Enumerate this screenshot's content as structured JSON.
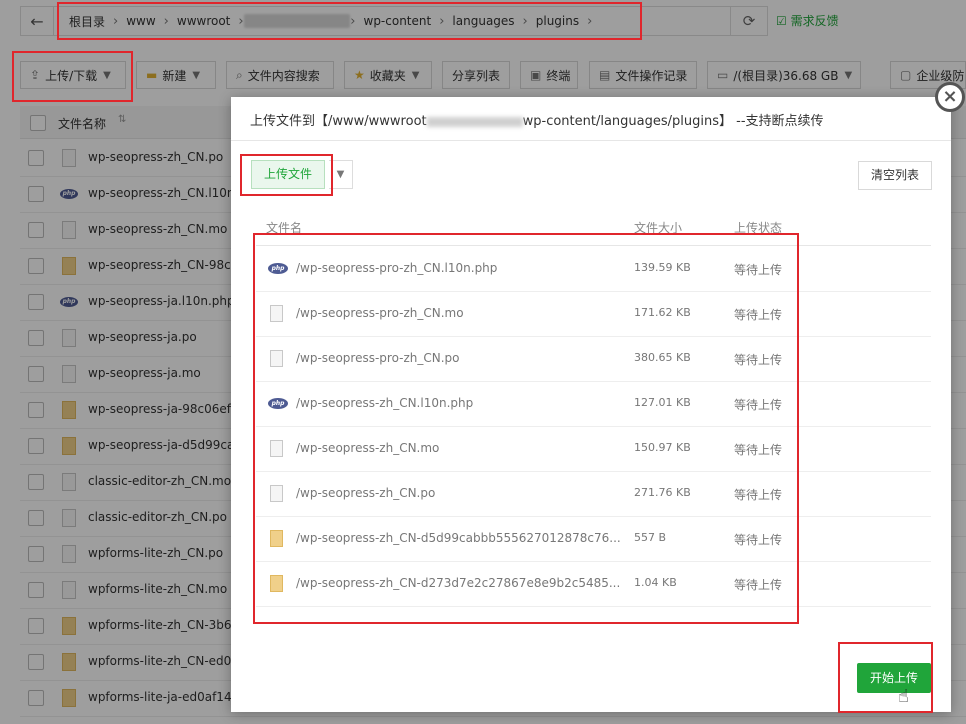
{
  "pathbar": {
    "back": "←",
    "crumbs": [
      "根目录",
      "www",
      "wwwroot",
      "wp-content",
      "languages",
      "plugins"
    ],
    "blurred_crumb": "■■■■■■■■",
    "refresh": "⟳"
  },
  "feedback": "需求反馈",
  "toolbar": {
    "upload_download": "上传/下载",
    "new": "新建",
    "content_search": "文件内容搜索",
    "favorites": "收藏夹",
    "share_list": "分享列表",
    "terminal": "终端",
    "file_log": "文件操作记录",
    "disk": "/(根目录)36.68 GB",
    "enterprise": "企业级防"
  },
  "file_list": {
    "header_name": "文件名称",
    "rows": [
      {
        "name": "wp-seopress-zh_CN.po",
        "icon": "doc"
      },
      {
        "name": "wp-seopress-zh_CN.l10n",
        "icon": "php"
      },
      {
        "name": "wp-seopress-zh_CN.mo",
        "icon": "doc"
      },
      {
        "name": "wp-seopress-zh_CN-98c",
        "icon": "json"
      },
      {
        "name": "wp-seopress-ja.l10n.php",
        "icon": "php"
      },
      {
        "name": "wp-seopress-ja.po",
        "icon": "doc"
      },
      {
        "name": "wp-seopress-ja.mo",
        "icon": "doc"
      },
      {
        "name": "wp-seopress-ja-98c06ef",
        "icon": "json"
      },
      {
        "name": "wp-seopress-ja-d5d99ca",
        "icon": "json"
      },
      {
        "name": "classic-editor-zh_CN.mo",
        "icon": "doc"
      },
      {
        "name": "classic-editor-zh_CN.po",
        "icon": "doc"
      },
      {
        "name": "wpforms-lite-zh_CN.po",
        "icon": "doc"
      },
      {
        "name": "wpforms-lite-zh_CN.mo",
        "icon": "doc"
      },
      {
        "name": "wpforms-lite-zh_CN-3b6",
        "icon": "json"
      },
      {
        "name": "wpforms-lite-zh_CN-ed0",
        "icon": "json"
      },
      {
        "name": "wpforms-lite-ja-ed0af14",
        "icon": "json"
      }
    ]
  },
  "modal": {
    "title_prefix": "上传文件到【/www/wwwroot",
    "title_suffix": "wp-content/languages/plugins】 --支持断点续传",
    "close": "×",
    "upload_btn": "上传文件",
    "clear_btn": "清空列表",
    "col_name": "文件名",
    "col_size": "文件大小",
    "col_status": "上传状态",
    "rows": [
      {
        "name": "/wp-seopress-pro-zh_CN.l10n.php",
        "size": "139.59 KB",
        "status": "等待上传",
        "icon": "php"
      },
      {
        "name": "/wp-seopress-pro-zh_CN.mo",
        "size": "171.62 KB",
        "status": "等待上传",
        "icon": "doc"
      },
      {
        "name": "/wp-seopress-pro-zh_CN.po",
        "size": "380.65 KB",
        "status": "等待上传",
        "icon": "doc"
      },
      {
        "name": "/wp-seopress-zh_CN.l10n.php",
        "size": "127.01 KB",
        "status": "等待上传",
        "icon": "php"
      },
      {
        "name": "/wp-seopress-zh_CN.mo",
        "size": "150.97 KB",
        "status": "等待上传",
        "icon": "doc"
      },
      {
        "name": "/wp-seopress-zh_CN.po",
        "size": "271.76 KB",
        "status": "等待上传",
        "icon": "doc"
      },
      {
        "name": "/wp-seopress-zh_CN-d5d99cabbb555627012878c76...",
        "size": "557 B",
        "status": "等待上传",
        "icon": "json"
      },
      {
        "name": "/wp-seopress-zh_CN-d273d7e2c27867e8e9b2c5485...",
        "size": "1.04 KB",
        "status": "等待上传",
        "icon": "json"
      }
    ],
    "start_btn": "开始上传"
  },
  "colors": {
    "accent": "#20a53a",
    "highlight": "#e0262c",
    "php": "#4e5b93"
  }
}
